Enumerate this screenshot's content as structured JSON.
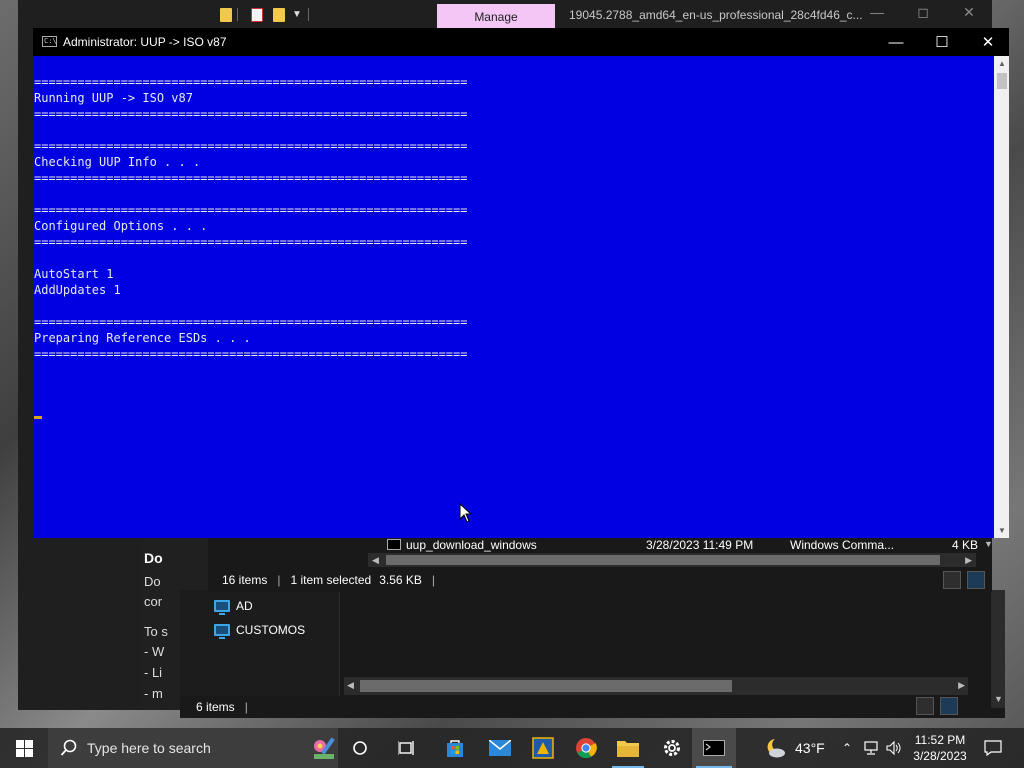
{
  "browser_bg": {
    "doc_title": "Do",
    "lines": [
      "Do",
      "cor",
      "To s",
      "- W",
      "- Li",
      "- m"
    ]
  },
  "explorer_front": {
    "manage_tab": "Manage",
    "window_title": "19045.2788_amd64_en-us_professional_28c4fd46_c...",
    "file": {
      "name": "uup_download_windows",
      "date": "3/28/2023 11:49 PM",
      "type": "Windows Comma...",
      "size": "4 KB"
    },
    "status": {
      "items": "16 items",
      "selected": "1 item selected",
      "size": "3.56 KB"
    }
  },
  "explorer_back": {
    "nav_items": [
      "AD",
      "CUSTOMOS"
    ],
    "status": {
      "items": "6 items"
    }
  },
  "cmd": {
    "title": "Administrator:  UUP -> ISO v87",
    "lines": [
      "============================================================",
      "Running UUP -> ISO v87",
      "============================================================",
      "",
      "============================================================",
      "Checking UUP Info . . .",
      "============================================================",
      "",
      "============================================================",
      "Configured Options . . .",
      "============================================================",
      "",
      "AutoStart 1",
      "AddUpdates 1",
      "",
      "============================================================",
      "Preparing Reference ESDs . . .",
      "============================================================"
    ],
    "colors": {
      "background": "#0000e0",
      "text": "#e8e8e8",
      "cursor": "#d6a520"
    }
  },
  "taskbar": {
    "search_placeholder": "Type here to search",
    "weather_temp": "43°F",
    "time": "11:52 PM",
    "date": "3/28/2023",
    "apps": [
      "cortana-icon",
      "task-view-icon",
      "store-icon",
      "mail-icon",
      "uup-tool-icon",
      "chrome-icon",
      "file-explorer-icon",
      "settings-icon",
      "terminal-icon"
    ]
  }
}
